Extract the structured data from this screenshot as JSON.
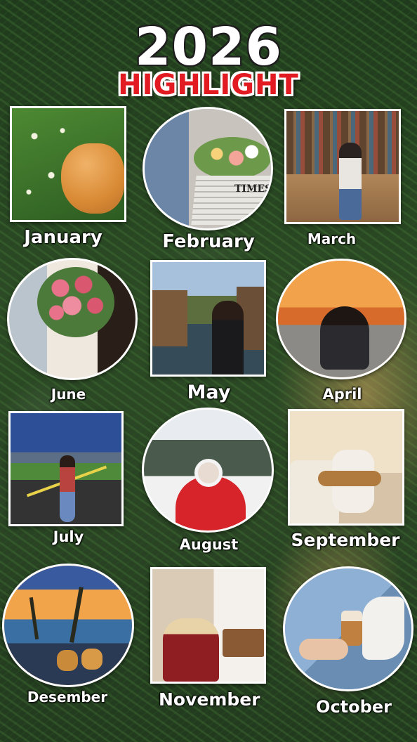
{
  "header": {
    "year": "2026",
    "subtitle": "HIGHLIGHT"
  },
  "months": {
    "january": "January",
    "february": "February",
    "march": "March",
    "june": "June",
    "may": "May",
    "april": "April",
    "july": "July",
    "august": "August",
    "september": "September",
    "desember": "Desember",
    "november": "November",
    "october": "October"
  },
  "newspaper": {
    "masthead": "TIMES"
  },
  "colors": {
    "title_red": "#e21b23",
    "frame": "#ffffff"
  }
}
